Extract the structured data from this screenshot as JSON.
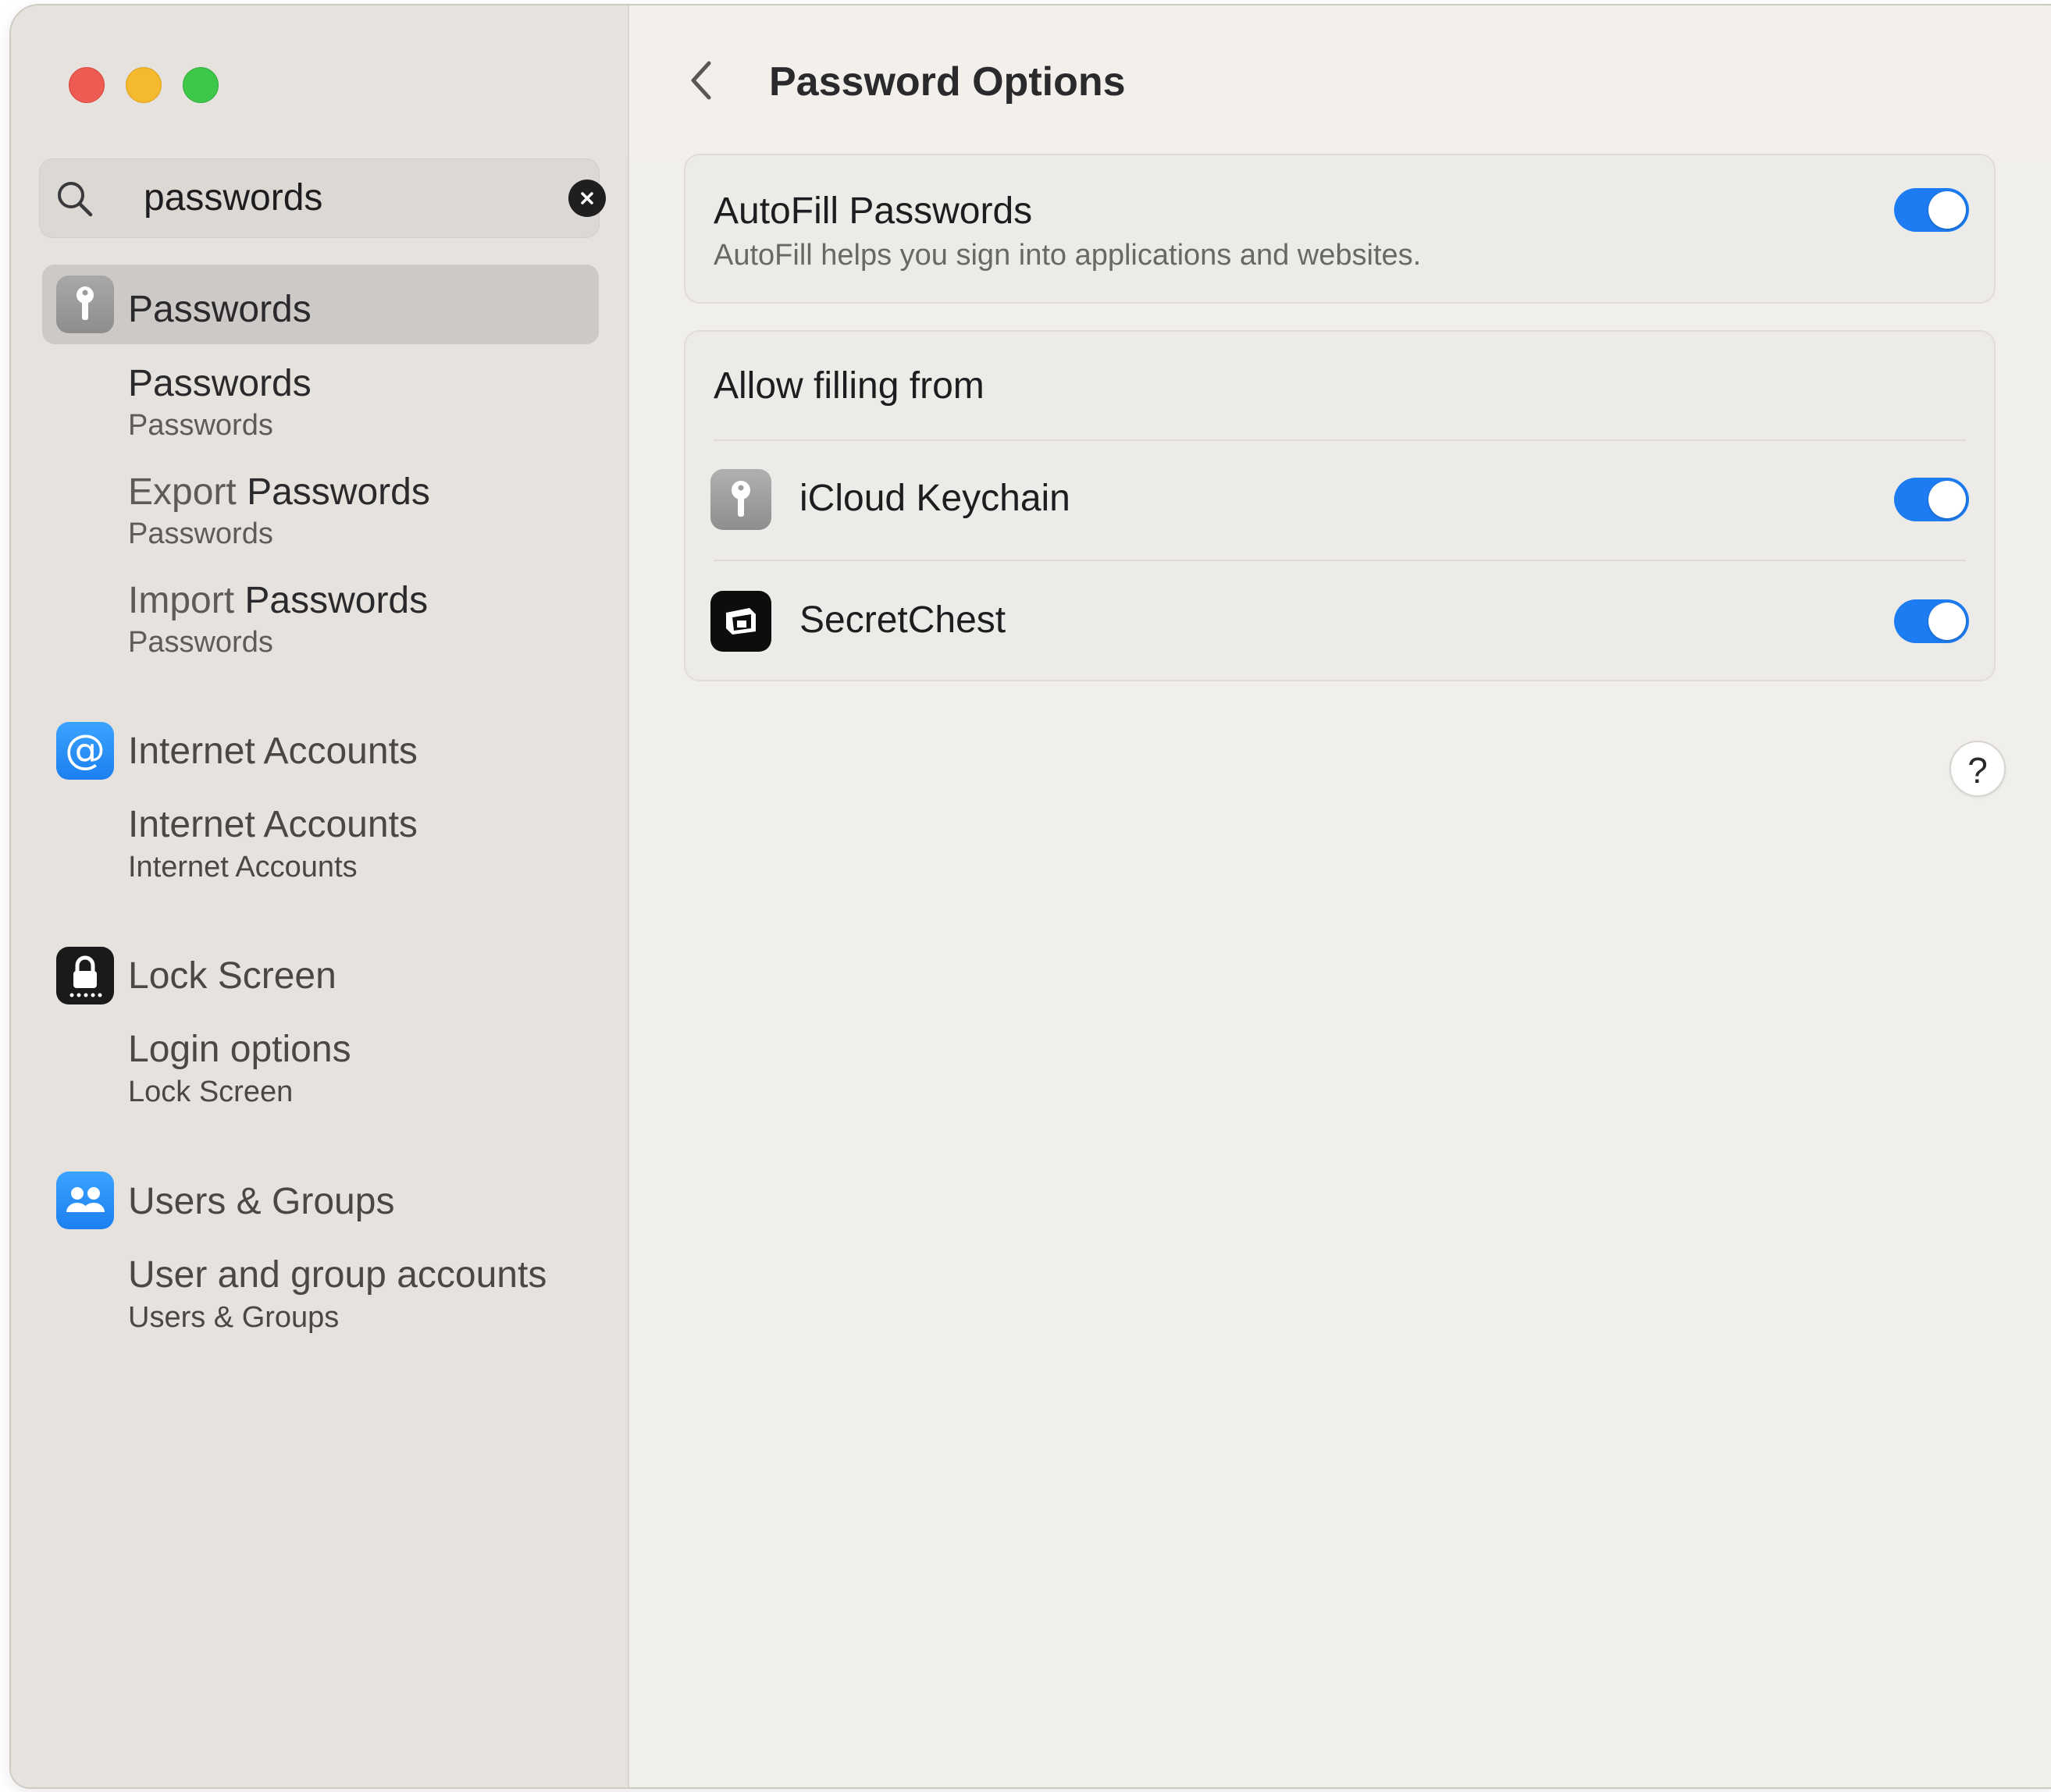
{
  "window": {
    "traffic_lights": [
      "close",
      "minimize",
      "zoom"
    ],
    "colors": {
      "close": "#ed5b53",
      "minimize": "#f5b92f",
      "zoom": "#3ec84a",
      "accent": "#1e7cf2"
    }
  },
  "search": {
    "value": "passwords",
    "icon": "search-icon",
    "clear_icon": "clear-icon"
  },
  "sidebar": {
    "groups": [
      {
        "label": "Passwords",
        "icon": "key-icon",
        "selected": true,
        "results": [
          {
            "title": "Passwords",
            "title_prefix": "",
            "caption": "Passwords"
          },
          {
            "title_prefix": "Export ",
            "title": "Passwords",
            "caption": "Passwords"
          },
          {
            "title_prefix": "Import ",
            "title": "Passwords",
            "caption": "Passwords"
          }
        ]
      },
      {
        "label": "Internet Accounts",
        "icon": "at-icon",
        "results": [
          {
            "title": "Internet Accounts",
            "caption": "Internet Accounts"
          }
        ]
      },
      {
        "label": "Lock Screen",
        "icon": "lock-icon",
        "results": [
          {
            "title": "Login options",
            "caption": "Lock Screen"
          }
        ]
      },
      {
        "label": "Users & Groups",
        "icon": "users-icon",
        "results": [
          {
            "title": "User and group accounts",
            "caption": "Users & Groups"
          }
        ]
      }
    ]
  },
  "main": {
    "back_icon": "chevron-left-icon",
    "title": "Password Options",
    "autofill": {
      "title": "AutoFill Passwords",
      "description": "AutoFill helps you sign into applications and websites.",
      "enabled": true
    },
    "allow_filling": {
      "header": "Allow filling from",
      "sources": [
        {
          "label": "iCloud Keychain",
          "icon": "keychain-icon",
          "enabled": true
        },
        {
          "label": "SecretChest",
          "icon": "secretchest-icon",
          "enabled": true
        }
      ]
    },
    "help_label": "?"
  }
}
